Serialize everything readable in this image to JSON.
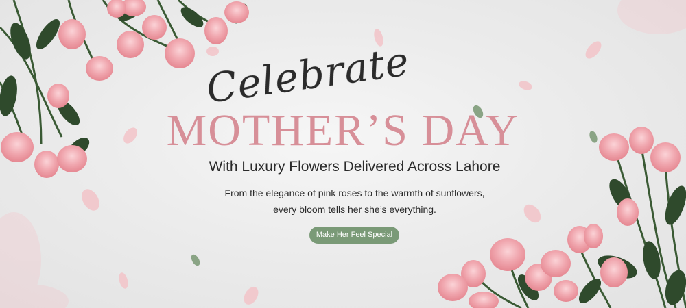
{
  "banner": {
    "script_title": "Celebrate",
    "main_title": "MOTHER’S DAY",
    "subtitle": "With Luxury Flowers Delivered Across Lahore",
    "description_line1": "From the elegance of pink roses to the warmth of sunflowers,",
    "description_line2": "every bloom tells her she’s everything.",
    "cta_label": "Make Her Feel Special"
  },
  "colors": {
    "title_pink": "#d78f98",
    "cta_green": "#7a9a77",
    "rose_pink": "#f0a6ae",
    "leaf_green": "#2f4a2c"
  },
  "decorations": [
    "rose-bouquet-top-left",
    "rose-bouquet-bottom-right",
    "falling-petal",
    "leaf"
  ]
}
